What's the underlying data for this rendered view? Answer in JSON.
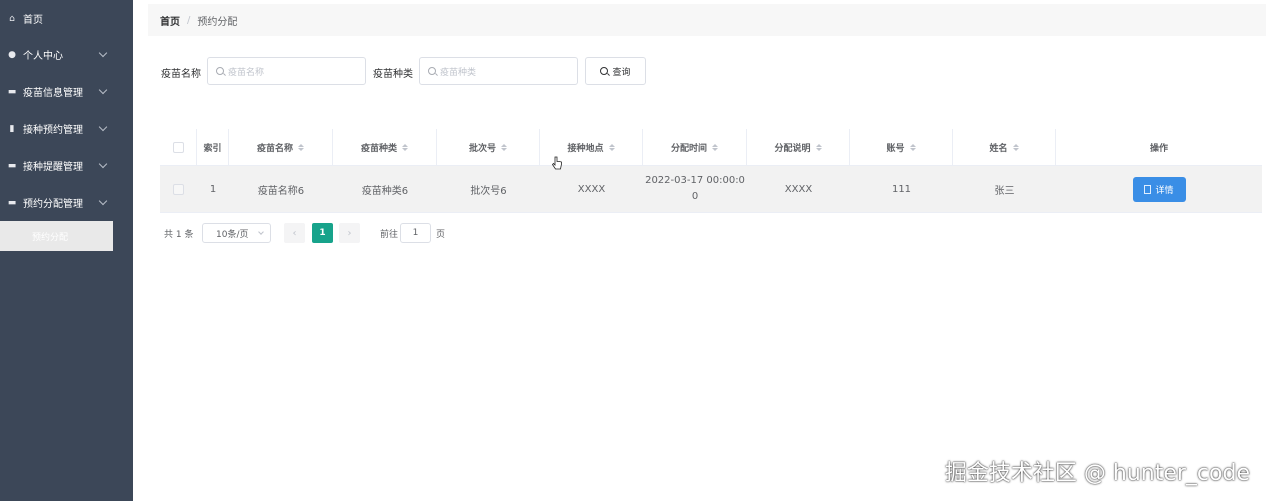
{
  "sidebar": {
    "items": [
      {
        "label": "首页",
        "icon": "home-icon",
        "has_children": false
      },
      {
        "label": "个人中心",
        "icon": "user-icon",
        "has_children": true
      },
      {
        "label": "疫苗信息管理",
        "icon": "folder-icon",
        "has_children": true
      },
      {
        "label": "接种预约管理",
        "icon": "clipboard-icon",
        "has_children": true
      },
      {
        "label": "接种提醒管理",
        "icon": "message-icon",
        "has_children": true
      },
      {
        "label": "预约分配管理",
        "icon": "document-icon",
        "has_children": true
      }
    ],
    "active_sub_item": "预约分配"
  },
  "breadcrumb": {
    "home": "首页",
    "separator": "/",
    "current": "预约分配"
  },
  "search": {
    "name_label": "疫苗名称",
    "name_placeholder": "疫苗名称",
    "type_label": "疫苗种类",
    "type_placeholder": "疫苗种类",
    "query_button": "查询"
  },
  "table": {
    "columns": [
      "索引",
      "疫苗名称",
      "疫苗种类",
      "批次号",
      "接种地点",
      "分配时间",
      "分配说明",
      "账号",
      "姓名",
      "操作"
    ],
    "rows": [
      {
        "index": "1",
        "vaccine_name": "疫苗名称6",
        "vaccine_type": "疫苗种类6",
        "batch": "批次号6",
        "location": "XXXX",
        "time_line1": "2022-03-17 00:00:0",
        "time_line2": "0",
        "note": "XXXX",
        "account": "111",
        "name": "张三",
        "action": "详情"
      }
    ]
  },
  "pagination": {
    "total": "共 1 条",
    "page_size": "10条/页",
    "prev": "‹",
    "current_page": "1",
    "next": "›",
    "goto_label": "前往",
    "goto_value": "1",
    "page_label": "页"
  },
  "watermark": "掘金技术社区 @ hunter_code",
  "colors": {
    "sidebar": "#3c4758",
    "accent": "#17a38b",
    "primary_button": "#3a8ee6"
  }
}
